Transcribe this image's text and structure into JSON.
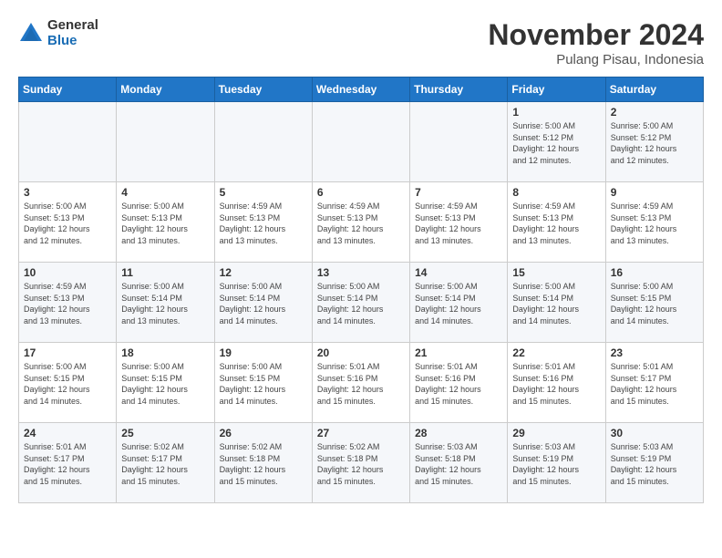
{
  "logo": {
    "general": "General",
    "blue": "Blue"
  },
  "header": {
    "month": "November 2024",
    "location": "Pulang Pisau, Indonesia"
  },
  "days_of_week": [
    "Sunday",
    "Monday",
    "Tuesday",
    "Wednesday",
    "Thursday",
    "Friday",
    "Saturday"
  ],
  "weeks": [
    [
      {
        "day": "",
        "content": ""
      },
      {
        "day": "",
        "content": ""
      },
      {
        "day": "",
        "content": ""
      },
      {
        "day": "",
        "content": ""
      },
      {
        "day": "",
        "content": ""
      },
      {
        "day": "1",
        "content": "Sunrise: 5:00 AM\nSunset: 5:12 PM\nDaylight: 12 hours\nand 12 minutes."
      },
      {
        "day": "2",
        "content": "Sunrise: 5:00 AM\nSunset: 5:12 PM\nDaylight: 12 hours\nand 12 minutes."
      }
    ],
    [
      {
        "day": "3",
        "content": "Sunrise: 5:00 AM\nSunset: 5:13 PM\nDaylight: 12 hours\nand 12 minutes."
      },
      {
        "day": "4",
        "content": "Sunrise: 5:00 AM\nSunset: 5:13 PM\nDaylight: 12 hours\nand 13 minutes."
      },
      {
        "day": "5",
        "content": "Sunrise: 4:59 AM\nSunset: 5:13 PM\nDaylight: 12 hours\nand 13 minutes."
      },
      {
        "day": "6",
        "content": "Sunrise: 4:59 AM\nSunset: 5:13 PM\nDaylight: 12 hours\nand 13 minutes."
      },
      {
        "day": "7",
        "content": "Sunrise: 4:59 AM\nSunset: 5:13 PM\nDaylight: 12 hours\nand 13 minutes."
      },
      {
        "day": "8",
        "content": "Sunrise: 4:59 AM\nSunset: 5:13 PM\nDaylight: 12 hours\nand 13 minutes."
      },
      {
        "day": "9",
        "content": "Sunrise: 4:59 AM\nSunset: 5:13 PM\nDaylight: 12 hours\nand 13 minutes."
      }
    ],
    [
      {
        "day": "10",
        "content": "Sunrise: 4:59 AM\nSunset: 5:13 PM\nDaylight: 12 hours\nand 13 minutes."
      },
      {
        "day": "11",
        "content": "Sunrise: 5:00 AM\nSunset: 5:14 PM\nDaylight: 12 hours\nand 13 minutes."
      },
      {
        "day": "12",
        "content": "Sunrise: 5:00 AM\nSunset: 5:14 PM\nDaylight: 12 hours\nand 14 minutes."
      },
      {
        "day": "13",
        "content": "Sunrise: 5:00 AM\nSunset: 5:14 PM\nDaylight: 12 hours\nand 14 minutes."
      },
      {
        "day": "14",
        "content": "Sunrise: 5:00 AM\nSunset: 5:14 PM\nDaylight: 12 hours\nand 14 minutes."
      },
      {
        "day": "15",
        "content": "Sunrise: 5:00 AM\nSunset: 5:14 PM\nDaylight: 12 hours\nand 14 minutes."
      },
      {
        "day": "16",
        "content": "Sunrise: 5:00 AM\nSunset: 5:15 PM\nDaylight: 12 hours\nand 14 minutes."
      }
    ],
    [
      {
        "day": "17",
        "content": "Sunrise: 5:00 AM\nSunset: 5:15 PM\nDaylight: 12 hours\nand 14 minutes."
      },
      {
        "day": "18",
        "content": "Sunrise: 5:00 AM\nSunset: 5:15 PM\nDaylight: 12 hours\nand 14 minutes."
      },
      {
        "day": "19",
        "content": "Sunrise: 5:00 AM\nSunset: 5:15 PM\nDaylight: 12 hours\nand 14 minutes."
      },
      {
        "day": "20",
        "content": "Sunrise: 5:01 AM\nSunset: 5:16 PM\nDaylight: 12 hours\nand 15 minutes."
      },
      {
        "day": "21",
        "content": "Sunrise: 5:01 AM\nSunset: 5:16 PM\nDaylight: 12 hours\nand 15 minutes."
      },
      {
        "day": "22",
        "content": "Sunrise: 5:01 AM\nSunset: 5:16 PM\nDaylight: 12 hours\nand 15 minutes."
      },
      {
        "day": "23",
        "content": "Sunrise: 5:01 AM\nSunset: 5:17 PM\nDaylight: 12 hours\nand 15 minutes."
      }
    ],
    [
      {
        "day": "24",
        "content": "Sunrise: 5:01 AM\nSunset: 5:17 PM\nDaylight: 12 hours\nand 15 minutes."
      },
      {
        "day": "25",
        "content": "Sunrise: 5:02 AM\nSunset: 5:17 PM\nDaylight: 12 hours\nand 15 minutes."
      },
      {
        "day": "26",
        "content": "Sunrise: 5:02 AM\nSunset: 5:18 PM\nDaylight: 12 hours\nand 15 minutes."
      },
      {
        "day": "27",
        "content": "Sunrise: 5:02 AM\nSunset: 5:18 PM\nDaylight: 12 hours\nand 15 minutes."
      },
      {
        "day": "28",
        "content": "Sunrise: 5:03 AM\nSunset: 5:18 PM\nDaylight: 12 hours\nand 15 minutes."
      },
      {
        "day": "29",
        "content": "Sunrise: 5:03 AM\nSunset: 5:19 PM\nDaylight: 12 hours\nand 15 minutes."
      },
      {
        "day": "30",
        "content": "Sunrise: 5:03 AM\nSunset: 5:19 PM\nDaylight: 12 hours\nand 15 minutes."
      }
    ]
  ]
}
